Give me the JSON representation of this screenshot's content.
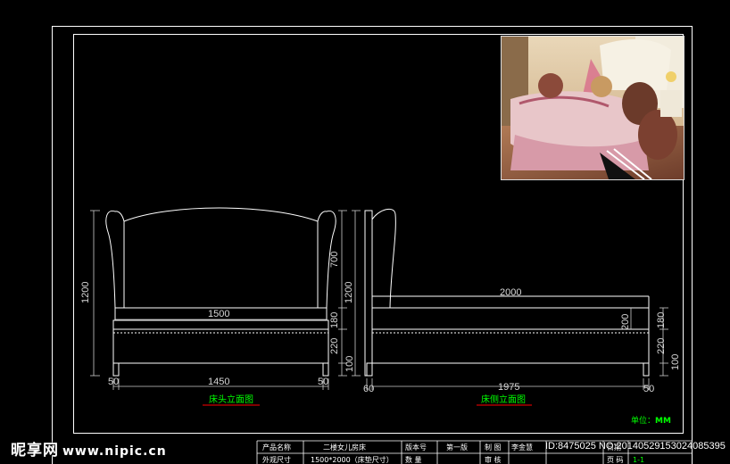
{
  "drawing": {
    "bed_head_view": {
      "title": "床头立面图",
      "dims": {
        "height": "1200",
        "headboard": "700",
        "mattress": "180",
        "base": "220",
        "legs": "100",
        "inner_width": "1500",
        "overall_width": "1450",
        "leg_left": "50",
        "leg_right": "50"
      }
    },
    "bed_side_view": {
      "title": "床侧立面图",
      "dims": {
        "height": "1200",
        "length": "2000",
        "overall_length": "1975",
        "footboard": "200",
        "mattress": "180",
        "base": "220",
        "legs": "100",
        "leg_left": "60",
        "leg_right": "50"
      }
    },
    "unit_label": "单位：",
    "unit_value": "MM"
  },
  "title_block": {
    "r1": [
      "产品名称",
      "二楼女儿房床",
      "版本号",
      "第一版",
      "制 图",
      "李金慧",
      "日期"
    ],
    "r2": [
      "外观尺寸",
      "1500*2000（床垫尺寸）",
      "数 量",
      "",
      "审 核",
      "",
      "页 码",
      "1-1"
    ]
  },
  "watermark": {
    "site_name": "昵享网",
    "site_url": "www.nipic.cn",
    "image_info": "ID:8475025 NO:20140529153024085395"
  },
  "colors": {
    "line": "#ffffff",
    "dim": "#d8d8d8",
    "title_green": "#00ff00",
    "unit_green": "#00ff00",
    "red": "#ff0000"
  }
}
